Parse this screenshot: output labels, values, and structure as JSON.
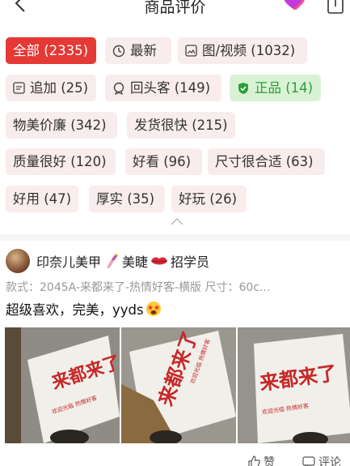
{
  "header": {
    "title": "商品评价",
    "back_icon": "chevron-left-icon",
    "share_icon": "share-icon",
    "heart_color": "#b92fd6"
  },
  "tags": [
    {
      "label": "全部 (2335)",
      "active": true
    },
    {
      "label": "最新",
      "icon": "clock-icon"
    },
    {
      "label": "图/视频 (1032)",
      "icon": "image-icon"
    },
    {
      "label": "追加 (25)",
      "icon": "note-icon"
    },
    {
      "label": "回头客 (149)",
      "icon": "badge-icon"
    },
    {
      "label": "正品 (14)",
      "icon": "shield-check-icon",
      "accent": "#2e9e3a"
    },
    {
      "label": "物美价廉 (342)"
    },
    {
      "label": "发货很快 (215)"
    },
    {
      "label": "质量很好 (120)"
    },
    {
      "label": "好看 (96)"
    },
    {
      "label": "尺寸很合适 (63)"
    },
    {
      "label": "好用 (47)"
    },
    {
      "label": "厚实 (35)"
    },
    {
      "label": "好玩 (26)"
    }
  ],
  "colors": {
    "active_tag": "#e53935",
    "tag_bg": "#f9ecec",
    "green_tag_bg": "#d9f2d6"
  },
  "review": {
    "user": {
      "name_part1": "印奈儿美甲",
      "name_part2": "美睫",
      "name_part3": "招学员"
    },
    "spec": "款式：2045A-来都来了-热情好客-横版   尺寸：60c...",
    "content": "超级喜欢，完美，yyds",
    "photos": [
      {
        "sign_text": "来都来了",
        "small_text": "欢迎光临  热情好客"
      },
      {
        "sign_text": "来都来了",
        "small_text": "欢迎光临  热情好客"
      },
      {
        "sign_text": "来都来了",
        "small_text": "欢迎光临  热情好客"
      }
    ],
    "actions": {
      "like": "赞",
      "comment": "评论"
    }
  }
}
